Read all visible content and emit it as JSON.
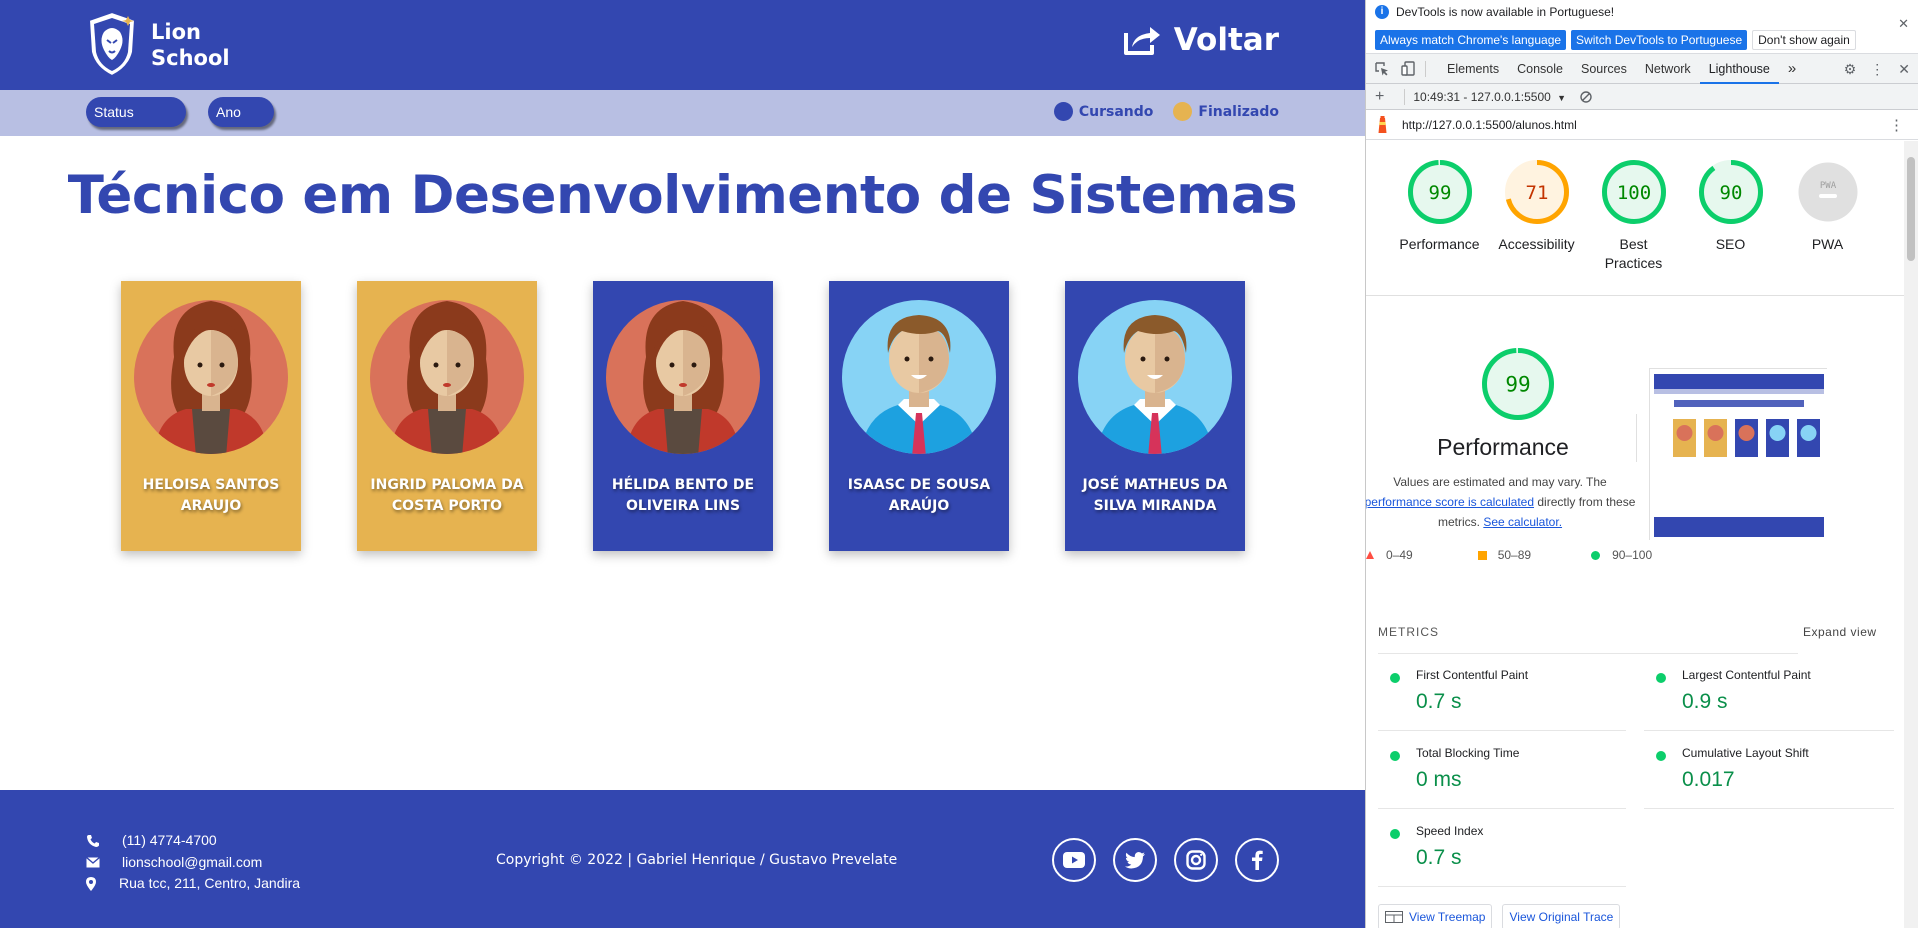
{
  "site": {
    "brand_line1": "Lion",
    "brand_line2": "School",
    "back_label": "Voltar",
    "filters": {
      "status": "Status",
      "ano": "Ano"
    },
    "legend": {
      "cursando": "Cursando",
      "finalizado": "Finalizado"
    },
    "title": "Técnico em Desenvolvimento de Sistemas",
    "colors": {
      "primary": "#3347b0",
      "finalizado": "#e6b350",
      "filterbar": "#b8bfe3"
    },
    "students": [
      {
        "name": "HELOISA SANTOS ARAUJO",
        "status": "finalizado",
        "avatar": "female"
      },
      {
        "name": "INGRID PALOMA DA COSTA PORTO",
        "status": "finalizado",
        "avatar": "female"
      },
      {
        "name": "HÉLIDA BENTO DE OLIVEIRA LINS",
        "status": "cursando",
        "avatar": "female"
      },
      {
        "name": "ISAASC DE SOUSA ARAÚJO",
        "status": "cursando",
        "avatar": "male"
      },
      {
        "name": "JOSÉ MATHEUS DA SILVA MIRANDA",
        "status": "cursando",
        "avatar": "male"
      }
    ],
    "footer": {
      "phone": "(11) 4774-4700",
      "email": "lionschool@gmail.com",
      "address": "Rua tcc, 211, Centro, Jandira",
      "copyright": "Copyright © 2022 | Gabriel Henrique / Gustavo Prevelate",
      "socials": [
        "youtube-icon",
        "twitter-icon",
        "instagram-icon",
        "facebook-icon"
      ]
    }
  },
  "devtools": {
    "info": {
      "message": "DevTools is now available in Portuguese!",
      "btn_match": "Always match Chrome's language",
      "btn_switch": "Switch DevTools to Portuguese",
      "btn_dismiss": "Don't show again"
    },
    "tabs": [
      "Elements",
      "Console",
      "Sources",
      "Network",
      "Lighthouse"
    ],
    "active_tab": "Lighthouse",
    "report_selector": "10:49:31 - 127.0.0.1:5500",
    "url": "http://127.0.0.1:5500/alunos.html",
    "scores": [
      {
        "label": "Performance",
        "value": "99",
        "score": 0.99,
        "grade": "pass"
      },
      {
        "label": "Accessibility",
        "value": "71",
        "score": 0.71,
        "grade": "average"
      },
      {
        "label": "Best Practices",
        "value": "100",
        "score": 1.0,
        "grade": "pass"
      },
      {
        "label": "SEO",
        "value": "90",
        "score": 0.9,
        "grade": "pass"
      },
      {
        "label": "PWA",
        "value": "PWA",
        "score": 0,
        "grade": "na"
      }
    ],
    "performance": {
      "score": "99",
      "title": "Performance",
      "desc_line1": "Values are estimated and may vary. The",
      "desc_link": "performance score is calculated",
      "desc_mid": "directly from these metrics.",
      "desc_link2": "See calculator."
    },
    "scale": [
      "0–49",
      "50–89",
      "90–100"
    ],
    "metrics_header": "METRICS",
    "expand_view": "Expand view",
    "metrics": [
      {
        "name": "First Contentful Paint",
        "value": "0.7 s"
      },
      {
        "name": "Largest Contentful Paint",
        "value": "0.9 s"
      },
      {
        "name": "Total Blocking Time",
        "value": "0 ms"
      },
      {
        "name": "Cumulative Layout Shift",
        "value": "0.017"
      },
      {
        "name": "Speed Index",
        "value": "0.7 s"
      }
    ],
    "view_treemap": "View Treemap",
    "view_trace": "View Original Trace",
    "colors": {
      "pass": "#0cce6b",
      "pass_text": "#008800",
      "average": "#ffa400",
      "average_text": "#c33300",
      "fail": "#ff4e42",
      "link": "#1a73e8"
    }
  }
}
